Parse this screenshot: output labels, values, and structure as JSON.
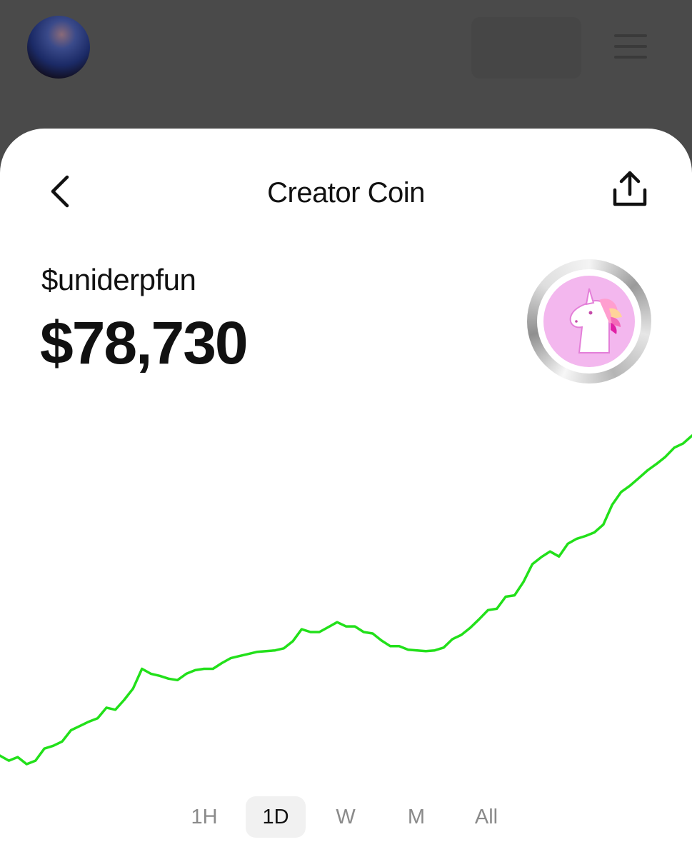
{
  "header": {
    "title": "Creator Coin"
  },
  "coin": {
    "ticker": "$uniderpfun",
    "price": "$78,730"
  },
  "timeframes": [
    {
      "label": "1H",
      "active": false
    },
    {
      "label": "1D",
      "active": true
    },
    {
      "label": "W",
      "active": false
    },
    {
      "label": "M",
      "active": false
    },
    {
      "label": "All",
      "active": false
    }
  ],
  "colors": {
    "line": "#22e01a",
    "background": "#ffffff",
    "overlay": "#4a4a4a",
    "badge": "#f3b7ee"
  },
  "chart_data": {
    "type": "line",
    "title": "",
    "xlabel": "",
    "ylabel": "",
    "grid": false,
    "series": [
      {
        "values": [
          47,
          40,
          45,
          35,
          40,
          57,
          61,
          67,
          83,
          89,
          95,
          100,
          115,
          112,
          126,
          142,
          170,
          163,
          160,
          156,
          154,
          163,
          168,
          170,
          170,
          178,
          185,
          188,
          191,
          194,
          195,
          196,
          199,
          209,
          226,
          222,
          222,
          229,
          236,
          230,
          230,
          222,
          220,
          210,
          202,
          202,
          197,
          196,
          195,
          196,
          200,
          212,
          218,
          228,
          240,
          253,
          255,
          272,
          274,
          293,
          318,
          328,
          336,
          329,
          347,
          354,
          358,
          363,
          374,
          402,
          420,
          429,
          440,
          451,
          460,
          470,
          483,
          489,
          500
        ]
      }
    ]
  }
}
